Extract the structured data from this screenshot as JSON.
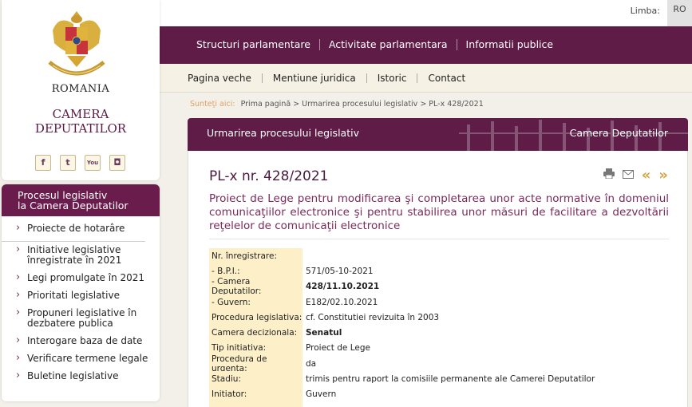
{
  "language": {
    "label": "Limba:",
    "current": "RO"
  },
  "logo": {
    "country": "ROMANIA",
    "institution_line1": "CAMERA",
    "institution_line2": "DEPUTATILOR",
    "crest_text": "CAMERA DEPUTATILOR"
  },
  "social": [
    {
      "icon": "facebook-icon",
      "glyph": "f"
    },
    {
      "icon": "twitter-icon",
      "glyph": "t"
    },
    {
      "icon": "youtube-icon",
      "glyph": "You"
    },
    {
      "icon": "instagram-icon",
      "glyph": "◘"
    }
  ],
  "sidebar": {
    "title_line1": "Procesul legislativ",
    "title_line2": "la Camera Deputatilor",
    "items": [
      {
        "label": "Proiecte de hotarâre"
      },
      {
        "label": "Initiative legislative înregistrate în 2021"
      },
      {
        "label": "Legi promulgate în 2021"
      },
      {
        "label": "Prioritati legislative"
      },
      {
        "label": "Propuneri legislative în dezbatere publica"
      },
      {
        "label": "Interogare baza de date"
      },
      {
        "label": "Verificare termene legale"
      },
      {
        "label": "Buletine legislative"
      }
    ]
  },
  "mainnav": {
    "items": [
      {
        "label": "Structuri parlamentare"
      },
      {
        "label": "Activitate parlamentara"
      },
      {
        "label": "Informatii publice"
      }
    ]
  },
  "subnav": {
    "items": [
      {
        "label": "Pagina veche"
      },
      {
        "label": "Mentiune juridica"
      },
      {
        "label": "Istoric"
      },
      {
        "label": "Contact"
      }
    ]
  },
  "breadcrumb": {
    "label": "Sunteţi aici:",
    "path": "Prima pagină > Urmarirea procesului legislativ > PL-x 428/2021"
  },
  "section": {
    "left": "Urmarirea procesului legislativ",
    "right": "Camera Deputatilor"
  },
  "document": {
    "title": "PL-x nr. 428/2021",
    "description": "Proiect de Lege pentru modificarea şi completarea unor acte normative în domeniul comunicaţiilor electronice şi pentru stabilirea unor măsuri de facilitare a dezvoltării reţelelor de comunicaţii electronice",
    "rows": [
      {
        "key": "Nr. înregistrare:",
        "value": "",
        "bold": false
      },
      {
        "key": " - B.P.I.:",
        "value": "571/05-10-2021",
        "bold": false
      },
      {
        "key": " - Camera Deputatilor:",
        "value": "428/11.10.2021",
        "bold": true
      },
      {
        "key": " - Guvern:",
        "value": "E182/02.10.2021",
        "bold": false
      },
      {
        "key": "Procedura legislativa:",
        "value": "cf. Constitutiei revizuita în 2003",
        "bold": false
      },
      {
        "key": "Camera decizionala:",
        "value": "Senatul",
        "bold": true
      },
      {
        "key": "Tip initiativa:",
        "value": "Proiect de Lege",
        "bold": false
      },
      {
        "key": "Procedura de urgenta:",
        "value": "da",
        "bold": false
      },
      {
        "key": "Stadiu:",
        "value": "trimis pentru raport la comisiile permanente ale Camerei Deputatilor",
        "bold": false
      },
      {
        "key": "Initiator:",
        "value": "Guvern",
        "bold": false
      }
    ]
  },
  "colors": {
    "brand": "#5e1c47",
    "accent": "#d8a33a",
    "label_bg": "#fdf0c8"
  }
}
